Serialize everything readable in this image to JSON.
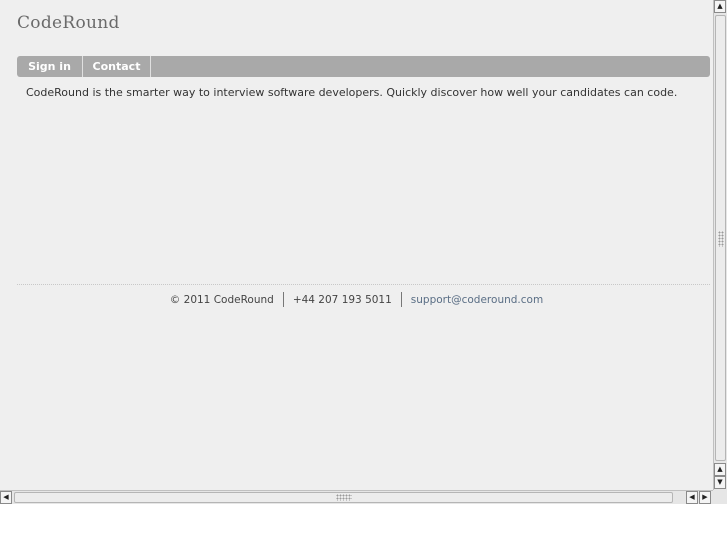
{
  "site": {
    "title": "CodeRound"
  },
  "nav": {
    "items": [
      {
        "label": "Sign in"
      },
      {
        "label": "Contact"
      }
    ]
  },
  "main": {
    "tagline": "CodeRound is the smarter way to interview software developers. Quickly discover how well your candidates can code."
  },
  "footer": {
    "copyright": "© 2011 CodeRound",
    "phone": "+44 207 193 5011",
    "email": "support@coderound.com"
  },
  "scrollbars": {
    "up_arrow": "▲",
    "down_arrow": "▼",
    "left_arrow": "◀",
    "right_arrow": "▶"
  },
  "colors": {
    "background": "#efefef",
    "navbar": "#a9a9a9",
    "link": "#5a6e85"
  }
}
